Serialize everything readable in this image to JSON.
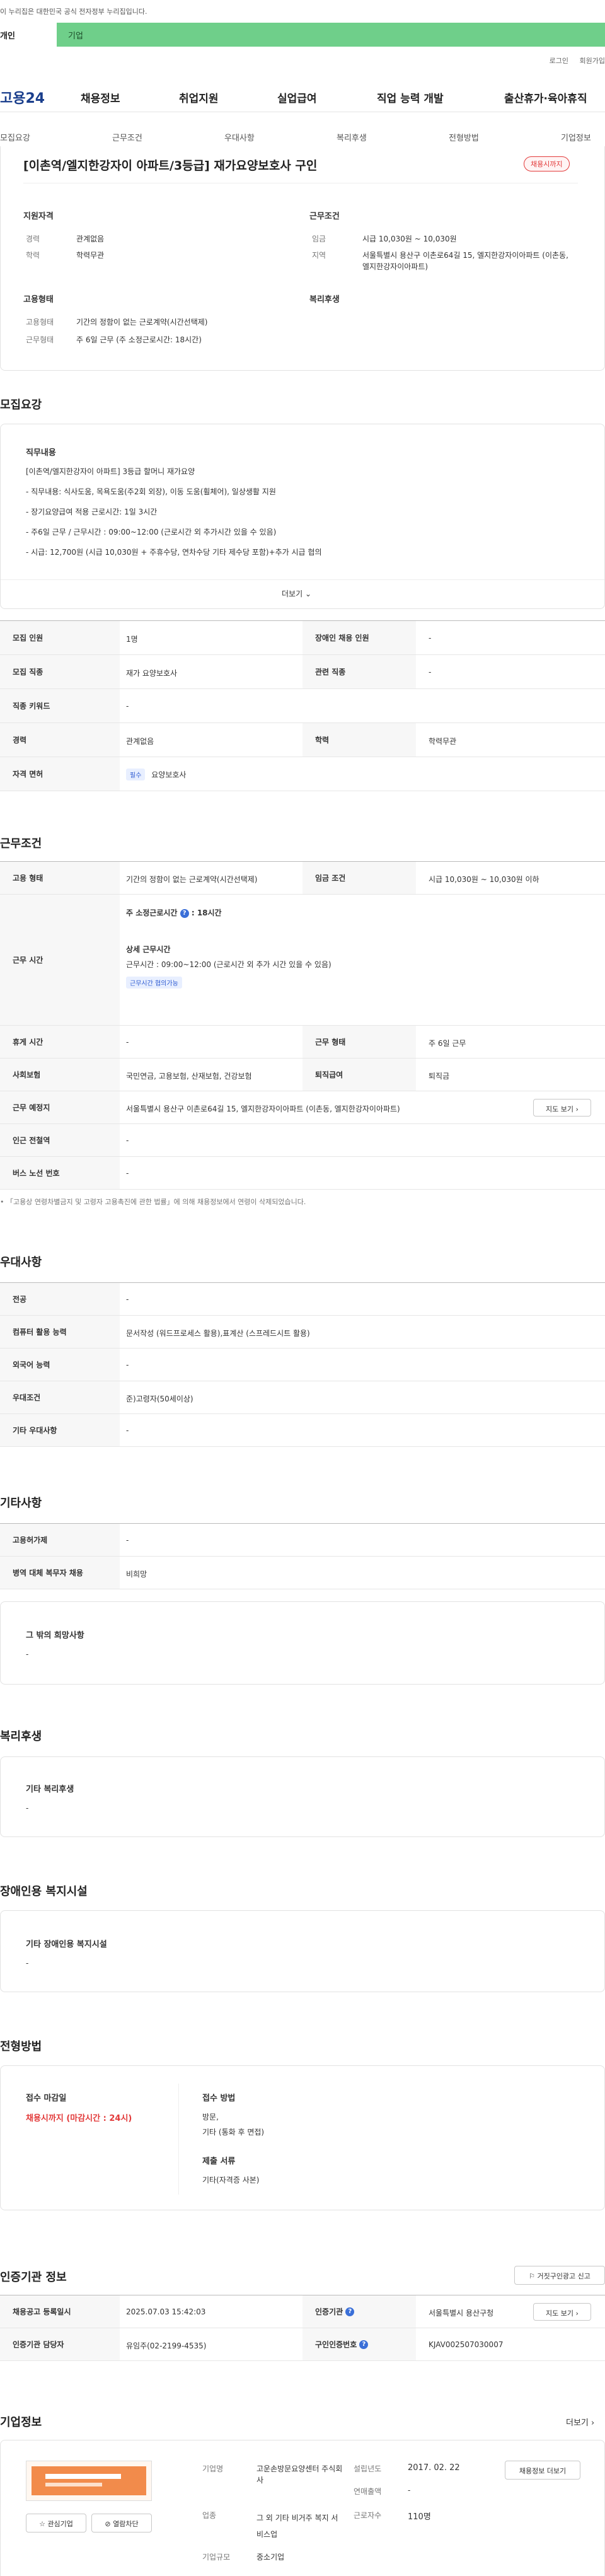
{
  "gov_banner": "이 누리집은 대한민국 공식 전자정부 누리집입니다.",
  "tabs": {
    "personal": "개인",
    "company": "기업"
  },
  "util": {
    "login": "로그인",
    "join": "회원가입"
  },
  "logo": "고용24",
  "gnb": [
    "채용정보",
    "취업지원",
    "실업급여",
    "직업 능력 개발",
    "출산휴가·육아휴직"
  ],
  "subnav": [
    "모집요강",
    "근무조건",
    "우대사항",
    "복리후생",
    "전형방법",
    "기업정보"
  ],
  "header": {
    "title": "[이촌역/엘지한강자이 아파트/3등급] 재가요양보호사 구인",
    "status_badge": "채용시까지",
    "qual_title": "지원자격",
    "career_label": "경력",
    "career_value": "관계없음",
    "edu_label": "학력",
    "edu_value": "학력무관",
    "cond_title": "근무조건",
    "wage_label": "임금",
    "wage_value": "시급 10,030원 ~ 10,030원",
    "region_label": "지역",
    "region_value": "서울특별시 용산구 이촌로64길 15, 엘지한강자이아파트 (이촌동, 엘지한강자이아파트)",
    "emp_title": "고용형태",
    "emp_type_label": "고용형태",
    "emp_type_value": "기간의 정함이 없는 근로계약(시간선택제)",
    "work_form_label": "근무형태",
    "work_form_value": "주 6일 근무 (주 소정근로시간: 18시간)",
    "welfare_title": "복리후생"
  },
  "recruit": {
    "section_title": "모집요강",
    "duty_title": "직무내용",
    "duty_lines": [
      "[이촌역/엘지한강자이 아파트]  3등급 할머니 재가요양",
      "- 직무내용:  식사도움, 목욕도움(주2회 외장), 이동 도움(휠체어), 일상생활 지원",
      "- 장기요양급여 적용 근로시간: 1일 3시간",
      "-  주6일 근무 /  근무시간 : 09:00~12:00 (근로시간 외 추가시간 있을 수 있음)",
      "- 시급: 12,700원 (시급 10,030원 + 주휴수당, 연차수당 기타 제수당 포함)+추가 시급 협의"
    ],
    "more": "더보기",
    "rows": [
      {
        "l1": "모집 인원",
        "v1": "1명",
        "l2": "장애인 채용 인원",
        "v2": "-"
      },
      {
        "l1": "모집 직종",
        "v1": "재가 요양보호사",
        "l2": "관련 직종",
        "v2": "-"
      },
      {
        "l1": "직종 키워드",
        "v1": "-"
      },
      {
        "l1": "경력",
        "v1": "관계없음",
        "l2": "학력",
        "v2": "학력무관"
      },
      {
        "l1": "자격 면허",
        "v1_tag": "필수",
        "v1": "요양보호사"
      }
    ]
  },
  "conditions": {
    "section_title": "근무조건",
    "emp_label": "고용 형태",
    "emp_value": "기간의 정함이 없는 근로계약(시간선택제)",
    "wage_label": "임금 조건",
    "wage_value": "시급 10,030원 ~ 10,030원 이하",
    "hours_label": "근무 시간",
    "weekly_hours_label": "주 소정근로시간",
    "weekly_hours_value": "18시간",
    "detail_title": "상세 근무시간",
    "detail_value": "근무시간 : 09:00~12:00 (근로시간 외 추가 시간 있을 수 있음)",
    "hours_tag": "근무시간 협의가능",
    "rest_label": "휴게 시간",
    "rest_value": "-",
    "form_label": "근무 형태",
    "form_value": "주 6일 근무",
    "insurance_label": "사회보험",
    "insurance_value": "국민연금, 고용보험, 산재보험, 건강보험",
    "severance_label": "퇴직급여",
    "severance_value": "퇴직금",
    "location_label": "근무 예정지",
    "location_value": "서울특별시 용산구 이촌로64길 15, 엘지한강자이아파트 (이촌동, 엘지한강자이아파트)",
    "map_button": "지도 보기",
    "subway_label": "인근 전철역",
    "subway_value": "-",
    "bus_label": "버스 노선 번호",
    "bus_value": "-",
    "notice": "「고용상 연령차별금지 및 고령자 고용촉진에 관한 법률」에 의해 채용정보에서 연령이 삭제되었습니다."
  },
  "preference": {
    "section_title": "우대사항",
    "rows": [
      {
        "l": "전공",
        "v": "-"
      },
      {
        "l": "컴퓨터 활용 능력",
        "v": "문서작성 (워드프로세스 활용),표계산 (스프레드시트 활용)"
      },
      {
        "l": "외국어 능력",
        "v": "-"
      },
      {
        "l": "우대조건",
        "v": "준)고령자(50세이상)"
      },
      {
        "l": "기타 우대사항",
        "v": "-"
      }
    ]
  },
  "other": {
    "section_title": "기타사항",
    "rows": [
      {
        "l": "고용허가제",
        "v": "-"
      },
      {
        "l": "병역 대체 복무자 채용",
        "v": "비희망"
      }
    ],
    "wish_title": "그 밖의 희망사항",
    "wish_value": "-"
  },
  "welfare": {
    "section_title": "복리후생",
    "box_title": "기타 복리후생",
    "box_value": "-"
  },
  "disabled": {
    "section_title": "장애인용 복지시설",
    "box_title": "기타 장애인용 복지시설",
    "box_value": "-"
  },
  "selection": {
    "section_title": "전형방법",
    "deadline_title": "접수 마감일",
    "deadline_value": "채용시까지 (마감시간 : 24시)",
    "method_title": "접수 방법",
    "method_lines": [
      "방문,",
      "기타 (통화 후 면접)"
    ],
    "docs_title": "제출 서류",
    "docs_value": "기타(자격증 사본)"
  },
  "cert": {
    "section_title": "인증기관 정보",
    "report_button": "거짓구인광고 신고",
    "reg_label": "채용공고 등록일시",
    "reg_value": "2025.07.03 15:42:03",
    "org_label": "인증기관",
    "org_value": "서울특별시 용산구청",
    "map_button": "지도 보기",
    "manager_label": "인증기관 담당자",
    "manager_value": "유임주(02-2199-4535)",
    "cert_no_label": "구인인증번호",
    "cert_no_value": "KJAV002507030007"
  },
  "company": {
    "section_title": "기업정보",
    "more": "더보기",
    "name_label": "기업명",
    "name_value": "고운손방문요양센터 주식회사",
    "est_label": "설립년도",
    "est_value": "2017. 02. 22",
    "sales_label": "연매출액",
    "sales_value": "-",
    "industry_label": "업종",
    "industry_value": "그 외 기타 비거주 복지 서비스업",
    "staff_label": "근로자수",
    "staff_value": "110명",
    "scale_label": "기업규모",
    "scale_value": "중소기업",
    "info_button": "채용정보 더보기",
    "fav_button": "관심기업",
    "block_button": "열람차단"
  }
}
